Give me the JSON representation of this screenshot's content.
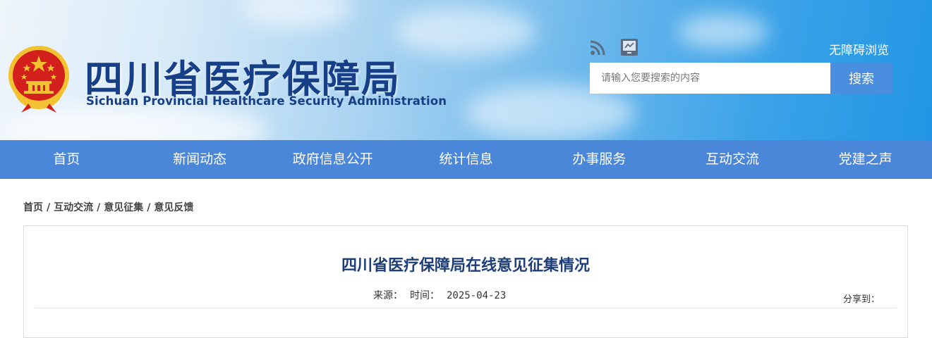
{
  "header": {
    "site_title": "四川省医疗保障局",
    "site_subtitle": "Sichuan Provincial Healthcare Security Administration",
    "accessibility_link": "无障碍浏览",
    "search": {
      "placeholder": "请输入您要搜索的内容",
      "button_label": "搜索"
    },
    "icons": [
      "emblem-icon",
      "rss-icon",
      "weixin-icon"
    ]
  },
  "nav": {
    "items": [
      {
        "label": "首页"
      },
      {
        "label": "新闻动态"
      },
      {
        "label": "政府信息公开"
      },
      {
        "label": "统计信息"
      },
      {
        "label": "办事服务"
      },
      {
        "label": "互动交流"
      },
      {
        "label": "党建之声"
      }
    ]
  },
  "breadcrumb": {
    "items": [
      "首页",
      "互动交流",
      "意见征集",
      "意见反馈"
    ],
    "separator": "/"
  },
  "article": {
    "title": "四川省医疗保障局在线意见征集情况",
    "source_label": "来源：",
    "time_label": "时间：",
    "date": "2025-04-23",
    "share_label": "分享到："
  },
  "colors": {
    "nav_background": "#4a87d9",
    "search_button": "#4a8ee0",
    "title_text": "#1d3e79",
    "emblem_red": "#d3201c",
    "emblem_gold": "#f2c230"
  }
}
